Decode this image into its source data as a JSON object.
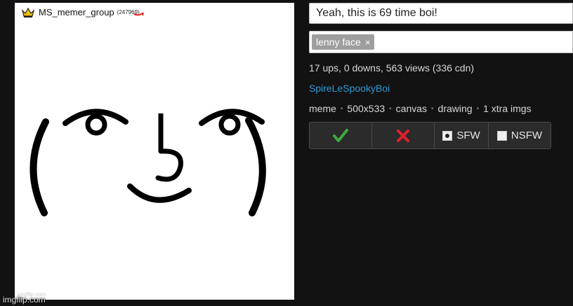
{
  "meme": {
    "group_name": "MS_memer_group",
    "group_count": "(247969)",
    "watermark": "imgflip.com",
    "imgflip_label": "imgflip.com"
  },
  "title": {
    "value": "Yeah, this is 69 time boi!"
  },
  "tags": [
    {
      "label": "lenny face",
      "remove": "×"
    }
  ],
  "stats": "17 ups, 0 downs, 563 views (336 cdn)",
  "author": "SpireLeSpookyBoi",
  "meta": [
    "meme",
    "500x533",
    "canvas",
    "drawing",
    "1 xtra imgs"
  ],
  "meta_separator": "•",
  "buttons": {
    "sfw_label": "SFW",
    "nsfw_label": "NSFW"
  },
  "colors": {
    "background": "#121212",
    "approve": "#3fa93f",
    "reject": "#e0202e",
    "author_link": "#2f9bd6"
  },
  "icons": [
    "crown-icon",
    "check-icon",
    "cross-icon"
  ]
}
